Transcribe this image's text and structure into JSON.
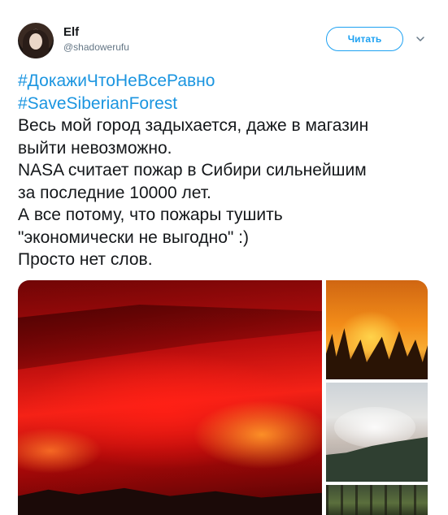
{
  "author": {
    "display_name": "Elf",
    "handle": "@shadowerufu"
  },
  "follow_button": {
    "label": "Читать"
  },
  "tweet": {
    "hashtags": [
      "#ДокажиЧтоНеВсеРавно",
      "#SaveSiberianForest"
    ],
    "lines": [
      "Весь мой город задыхается, даже в магазин",
      "выйти невозможно.",
      "NASA считает пожар в Сибири сильнейшим",
      "за последние 10000 лет.",
      "А все потому, что пожары тушить",
      "\"экономически не выгодно\" :)",
      "Просто нет слов."
    ]
  },
  "icons": {
    "chevron": "chevron-down-icon",
    "avatar": "avatar"
  },
  "colors": {
    "link": "#1b95e0",
    "accent": "#1da1f2",
    "text": "#14171a",
    "muted": "#657786"
  }
}
